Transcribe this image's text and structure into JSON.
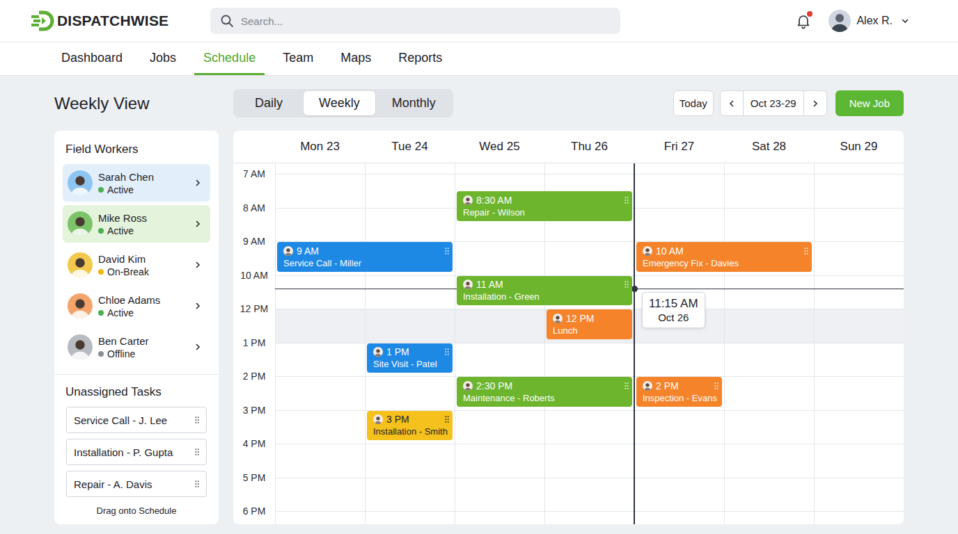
{
  "app": {
    "name": "DISPATCHWISE"
  },
  "search": {
    "placeholder": "Search..."
  },
  "notifications": {
    "unread": true
  },
  "user": {
    "name": "Alex R."
  },
  "nav": [
    {
      "label": "Dashboard",
      "selected": false
    },
    {
      "label": "Jobs",
      "selected": false
    },
    {
      "label": "Schedule",
      "selected": true
    },
    {
      "label": "Team",
      "selected": false
    },
    {
      "label": "Maps",
      "selected": false
    },
    {
      "label": "Reports",
      "selected": false
    }
  ],
  "page": {
    "title": "Weekly View"
  },
  "views": [
    {
      "label": "Daily",
      "selected": false
    },
    {
      "label": "Weekly",
      "selected": true
    },
    {
      "label": "Monthly",
      "selected": false
    }
  ],
  "toolbar": {
    "today": "Today",
    "range": "Oct 23-29",
    "new_job": "New Job"
  },
  "workers_panel": {
    "title": "Field Workers",
    "workers": [
      {
        "name": "Sarah Chen",
        "status": "Active",
        "color": "#4caf50",
        "avatar_color": "#8ec5f0",
        "selected": true,
        "highlighted": false
      },
      {
        "name": "Mike Ross",
        "status": "Active",
        "color": "#4caf50",
        "avatar_color": "#7cc46a",
        "selected": false,
        "highlighted": true
      },
      {
        "name": "David Kim",
        "status": "On-Break",
        "color": "#f5b70a",
        "avatar_color": "#f2c94c",
        "selected": false,
        "highlighted": false
      },
      {
        "name": "Chloe Adams",
        "status": "Active",
        "color": "#4caf50",
        "avatar_color": "#f2a46b",
        "selected": false,
        "highlighted": false
      },
      {
        "name": "Ben Carter",
        "status": "Offline",
        "color": "#8a8f96",
        "avatar_color": "#b8bcc2",
        "selected": false,
        "highlighted": false
      }
    ]
  },
  "tasks_panel": {
    "title": "Unassigned Tasks",
    "tasks": [
      "Service Call - J. Lee",
      "Installation - P. Gupta",
      "Repair - A. Davis"
    ],
    "hint": "Drag onto Schedule"
  },
  "calendar": {
    "days": [
      "Mon 23",
      "Tue 24",
      "Wed 25",
      "Thu 26",
      "Fri 27",
      "Sat 28",
      "Sun 29"
    ],
    "times": [
      "7 AM",
      "8 AM",
      "9 AM",
      "10 AM",
      "12 PM",
      "1 PM",
      "2 PM",
      "3 PM",
      "4 PM",
      "5 PM",
      "6 PM"
    ],
    "now": {
      "time": "11:15 AM",
      "date": "Oct 26"
    },
    "events": [
      {
        "time": "8:30 AM",
        "title": "Repair - Wilson",
        "day": "Wed 25",
        "color": "#6cb52d",
        "draggable": true
      },
      {
        "time": "9 AM",
        "title": "Service Call - Miller",
        "day": "Mon 23",
        "color": "#1e88e5",
        "draggable": true
      },
      {
        "time": "10 AM",
        "title": "Emergency Fix - Davies",
        "day": "Fri 27",
        "color": "#f5832a",
        "draggable": true
      },
      {
        "time": "11 AM",
        "title": "Installation - Green",
        "day": "Wed 25",
        "color": "#6cb52d",
        "draggable": true
      },
      {
        "time": "12 PM",
        "title": "Lunch",
        "day": "Thu 26",
        "color": "#f5832a",
        "draggable": false
      },
      {
        "time": "1 PM",
        "title": "Site Visit - Patel",
        "day": "Tue 24",
        "color": "#1e88e5",
        "draggable": true
      },
      {
        "time": "2:30 PM",
        "title": "Maintenance - Roberts",
        "day": "Wed 25",
        "color": "#6cb52d",
        "draggable": true
      },
      {
        "time": "2 PM",
        "title": "Inspection - Evans",
        "day": "Fri 27",
        "color": "#f5832a",
        "draggable": true
      },
      {
        "time": "3 PM",
        "title": "Installation - Smith",
        "day": "Tue 24",
        "color": "#f5c11c",
        "draggable": true
      }
    ]
  }
}
